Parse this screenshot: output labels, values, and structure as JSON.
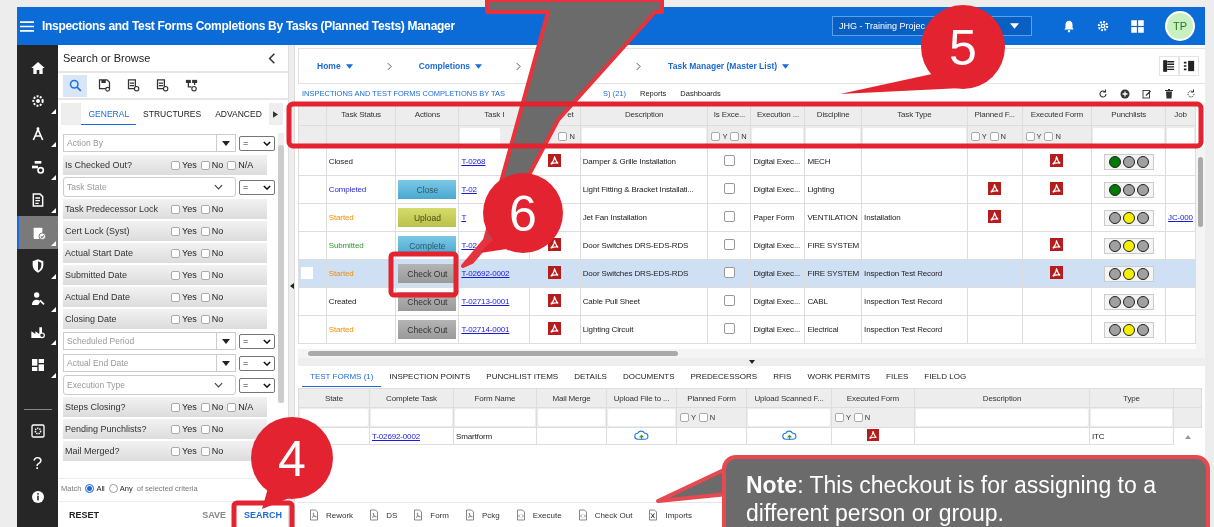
{
  "app_bar": {
    "title": "Inspections and Test Forms Completions By Tasks (Planned Tests) Manager",
    "project": "JHG - Training Projec",
    "avatar": "TP"
  },
  "rail": {
    "items": [
      {
        "kind": "home",
        "selected": false,
        "submenu": false
      },
      {
        "kind": "gear",
        "selected": false,
        "submenu": true
      },
      {
        "kind": "compass",
        "selected": false,
        "submenu": true
      },
      {
        "kind": "workflow",
        "selected": false,
        "submenu": true
      },
      {
        "kind": "document",
        "selected": false,
        "submenu": true
      },
      {
        "kind": "clipboard",
        "selected": true,
        "submenu": true
      },
      {
        "kind": "shield",
        "selected": false,
        "submenu": true
      },
      {
        "kind": "worker",
        "selected": false,
        "submenu": true
      },
      {
        "kind": "factory",
        "selected": false,
        "submenu": true
      },
      {
        "kind": "dashboard",
        "selected": false,
        "submenu": true
      }
    ],
    "bottom": [
      {
        "kind": "settings"
      },
      {
        "kind": "help",
        "glyph": "?"
      },
      {
        "kind": "info"
      }
    ]
  },
  "search_panel": {
    "title": "Search or Browse",
    "tools": [
      {
        "kind": "search",
        "selected": true
      },
      {
        "kind": "save",
        "selected": false
      },
      {
        "kind": "report",
        "selected": false
      },
      {
        "kind": "report",
        "selected": false
      },
      {
        "kind": "hierarchy",
        "selected": false
      }
    ],
    "tabs": [
      {
        "label": "GENERAL",
        "selected": true
      },
      {
        "label": "STRUCTURES",
        "selected": false
      },
      {
        "label": "ADVANCED",
        "selected": false
      }
    ],
    "criteria": [
      {
        "kind": "combo",
        "placeholder": "Action By",
        "operator": "="
      },
      {
        "kind": "flags",
        "label": "Is Checked Out?",
        "options": [
          {
            "label": "Yes",
            "checked": false
          },
          {
            "label": "No",
            "checked": false
          },
          {
            "label": "N/A",
            "checked": false
          }
        ]
      },
      {
        "kind": "select",
        "placeholder": "Task State",
        "operator": "="
      },
      {
        "kind": "flags",
        "label": "Task Predecessor Lock",
        "options": [
          {
            "label": "Yes",
            "checked": false
          },
          {
            "label": "No",
            "checked": false
          }
        ]
      },
      {
        "kind": "flags",
        "label": "Cert Lock (Syst)",
        "options": [
          {
            "label": "Yes",
            "checked": false
          },
          {
            "label": "No",
            "checked": false
          }
        ]
      },
      {
        "kind": "flags",
        "label": "Actual Start Date",
        "options": [
          {
            "label": "Yes",
            "checked": false
          },
          {
            "label": "No",
            "checked": false
          }
        ]
      },
      {
        "kind": "flags",
        "label": "Submitted Date",
        "options": [
          {
            "label": "Yes",
            "checked": false
          },
          {
            "label": "No",
            "checked": false
          }
        ]
      },
      {
        "kind": "flags",
        "label": "Actual End Date",
        "options": [
          {
            "label": "Yes",
            "checked": false
          },
          {
            "label": "No",
            "checked": false
          }
        ]
      },
      {
        "kind": "flags",
        "label": "Closing Date",
        "options": [
          {
            "label": "Yes",
            "checked": false
          },
          {
            "label": "No",
            "checked": false
          }
        ]
      },
      {
        "kind": "combo",
        "placeholder": "Scheduled Period",
        "operator": "="
      },
      {
        "kind": "combo",
        "placeholder": "Actual End Date",
        "operator": "="
      },
      {
        "kind": "select",
        "placeholder": "Execution Type",
        "operator": "="
      },
      {
        "kind": "flags",
        "label": "Steps Closing?",
        "options": [
          {
            "label": "Yes",
            "checked": false
          },
          {
            "label": "No",
            "checked": false
          },
          {
            "label": "N/A",
            "checked": false
          }
        ]
      },
      {
        "kind": "flags",
        "label": "Pending Punchlists?",
        "options": [
          {
            "label": "Yes",
            "checked": false
          },
          {
            "label": "No",
            "checked": false
          }
        ]
      },
      {
        "kind": "flags",
        "label": "Mail Merged?",
        "options": [
          {
            "label": "Yes",
            "checked": false
          },
          {
            "label": "No",
            "checked": false
          }
        ]
      }
    ],
    "match": {
      "label": "Match",
      "options": [
        {
          "label": "All",
          "selected": true
        },
        {
          "label": "Any",
          "selected": false
        }
      ],
      "suffix": "of selected criteria"
    },
    "buttons": [
      {
        "label": "RESET",
        "kind": "plain"
      },
      {
        "label": "SAVE",
        "kind": "muted"
      },
      {
        "label": "SEARCH",
        "kind": "primary"
      }
    ]
  },
  "breadcrumbs": [
    {
      "label": "Home"
    },
    {
      "label": "Completions"
    },
    {
      "label": "Task Manager (Master List)"
    }
  ],
  "grid_title": [
    "INSPECTIONS AND TEST FORMS COMPLETIONS BY TAS",
    "S) (21)"
  ],
  "grid_links": [
    "Reports",
    "Dashboards"
  ],
  "grid_tools": [
    {
      "kind": "refresh"
    },
    {
      "kind": "add"
    },
    {
      "kind": "edit"
    },
    {
      "kind": "delete"
    },
    {
      "kind": "reset"
    }
  ],
  "columns": [
    {
      "kind": "plain"
    },
    {
      "label": "Task Status",
      "kind": "plain"
    },
    {
      "label": "Actions",
      "kind": "plain"
    },
    {
      "label": "Task I",
      "kind": "text"
    },
    {
      "label": "et",
      "kind": "yn",
      "filter_options": [
        {
          "label": "N",
          "checked": false
        }
      ]
    },
    {
      "label": "Description",
      "kind": "text"
    },
    {
      "label": "Is Exce...",
      "kind": "yn",
      "filter_options": [
        {
          "label": "Y",
          "checked": false
        },
        {
          "label": "N",
          "checked": false
        }
      ]
    },
    {
      "label": "Execution ...",
      "kind": "text"
    },
    {
      "label": "Discipline",
      "kind": "text"
    },
    {
      "label": "Task Type",
      "kind": "text"
    },
    {
      "label": "Planned F...",
      "kind": "yn",
      "filter_options": [
        {
          "label": "Y",
          "checked": false
        },
        {
          "label": "N",
          "checked": false
        }
      ]
    },
    {
      "label": "Executed Form",
      "kind": "yn",
      "filter_options": [
        {
          "label": "Y",
          "checked": false
        },
        {
          "label": "N",
          "checked": false
        }
      ]
    },
    {
      "label": "Punchlists",
      "kind": "text"
    },
    {
      "label": "Job",
      "kind": "text"
    }
  ],
  "rows": [
    {
      "selected": false,
      "status": "Closed",
      "kind": "closed",
      "task_id": "T-0268",
      "sheet_pdf": true,
      "description": "Damper & Grille Installation",
      "exec_checked": false,
      "execution": "Digital Exec...",
      "discipline": "MECH",
      "planned_pdf": false,
      "executed_pdf": true,
      "punchlist": [
        {
          "color": "#007a00"
        },
        {
          "color": "#a0a0a0"
        },
        {
          "color": "#a0a0a0"
        }
      ]
    },
    {
      "selected": false,
      "status": "Completed",
      "kind": "completed",
      "action": {
        "label": "Close",
        "kind": "info"
      },
      "task_id": "T-02",
      "sheet_pdf": false,
      "description": "Light Fitting & Bracket Installati...",
      "exec_checked": false,
      "execution": "Digital Exec...",
      "discipline": "Lighting",
      "planned_pdf": true,
      "executed_pdf": true,
      "punchlist": [
        {
          "color": "#007a00"
        },
        {
          "color": "#a0a0a0"
        },
        {
          "color": "#a0a0a0"
        }
      ]
    },
    {
      "selected": false,
      "status": "Started",
      "kind": "started",
      "action": {
        "label": "Upload",
        "kind": "warning"
      },
      "task_id": "T",
      "sheet_pdf": false,
      "description": "Jet Fan Installation",
      "exec_checked": false,
      "execution": "Paper Form",
      "discipline": "VENTILATION",
      "task_type": "Installation",
      "planned_pdf": true,
      "executed_pdf": false,
      "punchlist": [
        {
          "color": "#a0a0a0"
        },
        {
          "color": "#f5f000"
        },
        {
          "color": "#a0a0a0"
        }
      ],
      "job": "JC-000"
    },
    {
      "selected": false,
      "status": "Submitted",
      "kind": "submitted",
      "action": {
        "label": "Complete",
        "kind": "info"
      },
      "task_id": "T-02",
      "sheet_pdf": true,
      "description": "Door Switches DRS-EDS-RDS",
      "exec_checked": false,
      "execution": "Digital Exec...",
      "discipline": "FIRE SYSTEM",
      "planned_pdf": false,
      "executed_pdf": true,
      "punchlist": [
        {
          "color": "#a0a0a0"
        },
        {
          "color": "#f5f000"
        },
        {
          "color": "#a0a0a0"
        }
      ]
    },
    {
      "selected": true,
      "status": "Started",
      "kind": "started",
      "action": {
        "label": "Check Out",
        "kind": "muted"
      },
      "task_id": "T-02692-0002",
      "sheet_pdf": true,
      "description": "Door Switches DRS-EDS-RDS",
      "exec_checked": false,
      "execution": "Digital Exec...",
      "discipline": "FIRE SYSTEM",
      "task_type": "Inspection Test Record",
      "planned_pdf": false,
      "executed_pdf": true,
      "punchlist": [
        {
          "color": "#a0a0a0"
        },
        {
          "color": "#f5f000"
        },
        {
          "color": "#a0a0a0"
        }
      ]
    },
    {
      "selected": false,
      "status": "Created",
      "kind": "created",
      "action": {
        "label": "Check Out",
        "kind": "muted"
      },
      "task_id": "T-02713-0001",
      "sheet_pdf": true,
      "description": "Cable Pull Sheet",
      "exec_checked": false,
      "execution": "Digital Exec...",
      "discipline": "CABL",
      "task_type": "Inspection Test Record",
      "planned_pdf": false,
      "executed_pdf": false,
      "punchlist": [
        {
          "color": "#a0a0a0"
        },
        {
          "color": "#a0a0a0"
        },
        {
          "color": "#a0a0a0"
        }
      ]
    },
    {
      "selected": false,
      "status": "Started",
      "kind": "started",
      "action": {
        "label": "Check Out",
        "kind": "muted"
      },
      "task_id": "T-02714-0001",
      "sheet_pdf": true,
      "description": "Lighting Circuit",
      "exec_checked": false,
      "execution": "Digital Exec...",
      "discipline": "Electrical",
      "task_type": "Inspection Test Record",
      "planned_pdf": false,
      "executed_pdf": false,
      "punchlist": [
        {
          "color": "#a0a0a0"
        },
        {
          "color": "#f5f000"
        },
        {
          "color": "#a0a0a0"
        }
      ]
    }
  ],
  "detail_tabs": [
    {
      "label": "TEST FORMS (1)",
      "selected": true
    },
    {
      "label": "INSPECTION POINTS",
      "selected": false
    },
    {
      "label": "PUNCHLIST ITEMS",
      "selected": false
    },
    {
      "label": "DETAILS",
      "selected": false
    },
    {
      "label": "DOCUMENTS",
      "selected": false
    },
    {
      "label": "PREDECESSORS",
      "selected": false
    },
    {
      "label": "RFIS",
      "selected": false
    },
    {
      "label": "WORK PERMITS",
      "selected": false
    },
    {
      "label": "FILES",
      "selected": false
    },
    {
      "label": "FIELD LOG",
      "selected": false
    }
  ],
  "form_columns": [
    {
      "label": "State",
      "kind": "text"
    },
    {
      "label": "Complete Task",
      "kind": "text"
    },
    {
      "label": "Form Name",
      "kind": "text"
    },
    {
      "label": "Mail Merge",
      "kind": "text"
    },
    {
      "label": "Upload File to ...",
      "kind": "text"
    },
    {
      "label": "Planned Form",
      "kind": "yn",
      "filter_options": [
        {
          "label": "Y",
          "checked": false
        },
        {
          "label": "N",
          "checked": false
        }
      ]
    },
    {
      "label": "Upload Scanned F...",
      "kind": "text"
    },
    {
      "label": "Executed Form",
      "kind": "yn",
      "filter_options": [
        {
          "label": "Y",
          "checked": false
        },
        {
          "label": "N",
          "checked": false
        }
      ]
    },
    {
      "label": "Description",
      "kind": "text"
    },
    {
      "label": "Type",
      "kind": "text"
    }
  ],
  "form_rows": [
    {
      "complete_task": "T-02692-0002",
      "form_name": "Smartform",
      "upload_file": true,
      "upload_scanned": true,
      "executed_pdf": true,
      "type": "ITC"
    }
  ],
  "actions_bar": [
    {
      "kind": "pdf",
      "label": "Rework"
    },
    {
      "kind": "pdf",
      "label": "DS"
    },
    {
      "kind": "pdf",
      "label": "Form"
    },
    {
      "kind": "pdf",
      "label": "Pckg"
    },
    {
      "kind": "code",
      "label": "Execute"
    },
    {
      "kind": "code",
      "label": "Check Out"
    },
    {
      "kind": "excel",
      "label": "Imports"
    }
  ],
  "annotations": {
    "callouts": [
      "5",
      "6",
      "4"
    ],
    "note": "**Note**: This checkout is for assigning to a different person or group."
  }
}
